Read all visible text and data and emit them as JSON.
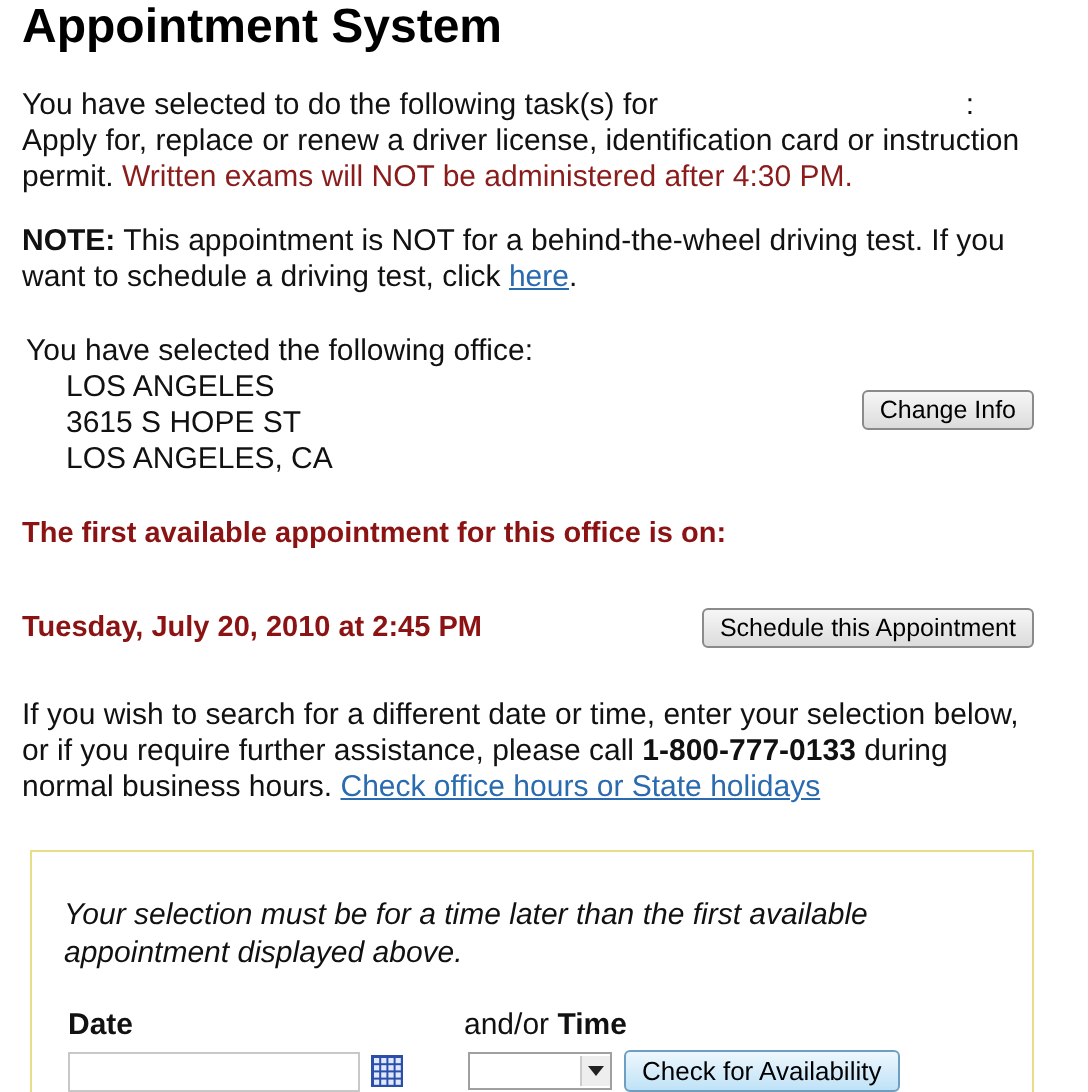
{
  "title": "Appointment System",
  "task": {
    "intro": "You have selected to do the following task(s) for",
    "colon": ":",
    "description": "Apply for, replace or renew a driver license, identification card or instruction permit.",
    "warning": "Written exams will NOT be administered after 4:30 PM."
  },
  "note": {
    "text": "**NOTE:** This appointment is NOT for a behind-the-wheel driving test. If you want to schedule a driving test, click",
    "link": "here",
    "end": "."
  },
  "office": {
    "label": "You have selected the following office:",
    "lines": [
      "LOS ANGELES",
      "3615 S HOPE ST",
      "LOS ANGELES, CA"
    ],
    "button": "Change Info"
  },
  "first_available": {
    "heading": "The first available appointment for this office is on:",
    "date": "Tuesday, July 20, 2010 at 2:45 PM",
    "button": "Schedule this Appointment"
  },
  "search_info": {
    "text": "If you wish to search for a different date or time, enter your selection below, or if you require further assistance, please call **1-800-777-0133** during normal business hours.",
    "link": "Check office hours or State holidays"
  },
  "search_form": {
    "note": "Your selection must be for a time later than the first available appointment displayed above.",
    "date_label": "Date",
    "connector": "and/or",
    "time_label": "Time",
    "button": "Check for Availability"
  }
}
